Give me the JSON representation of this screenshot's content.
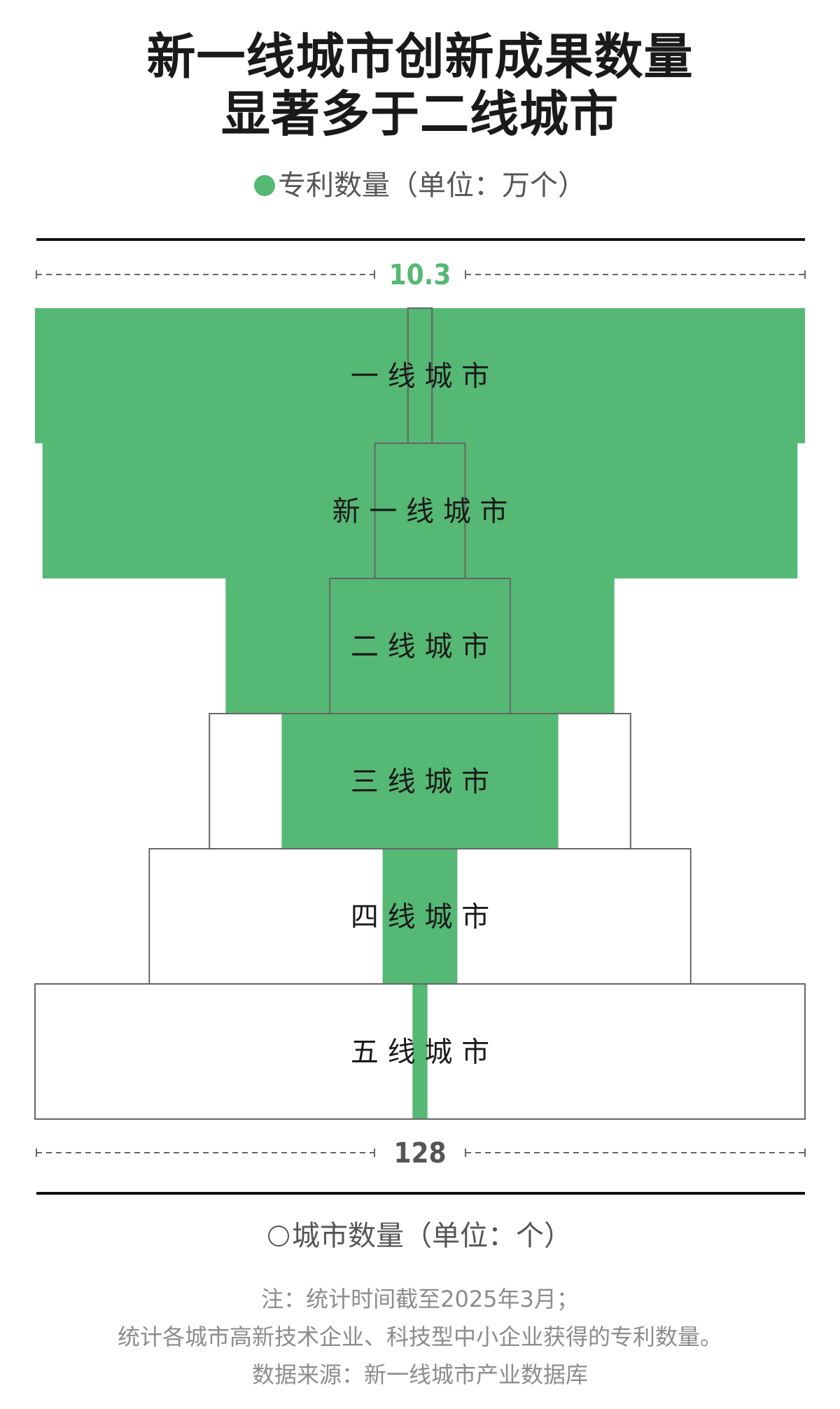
{
  "header": {
    "title_line1": "新一线城市创新成果数量",
    "title_line2": "显著多于二线城市"
  },
  "legend": {
    "patents_label": "专利数量（单位：万个）",
    "cities_label": "城市数量（单位：个）"
  },
  "chart_data": {
    "type": "bar",
    "title": "新一线城市创新成果数量显著多于二线城市",
    "categories": [
      "一 线 城 市",
      "新 一 线 城 市",
      "二 线 城 市",
      "三 线 城 市",
      "四 线 城 市",
      "五 线 城 市"
    ],
    "series": [
      {
        "name": "专利数量（单位：万个）",
        "values": [
          10.3,
          10.1,
          5.2,
          3.7,
          1.0,
          0.2
        ],
        "color": "#55b874"
      },
      {
        "name": "城市数量（单位：个）",
        "values": [
          4,
          15,
          30,
          70,
          90,
          128
        ],
        "color": "#ffffff"
      }
    ],
    "patent_scale_label": "10.3",
    "city_scale_label": "128",
    "patent_max": 10.3,
    "city_max": 128
  },
  "notes": {
    "line1": "注：统计时间截至2025年3月；",
    "line2": "统计各城市高新技术企业、科技型中小企业获得的专利数量。",
    "line3": "数据来源：新一线城市产业数据库"
  }
}
